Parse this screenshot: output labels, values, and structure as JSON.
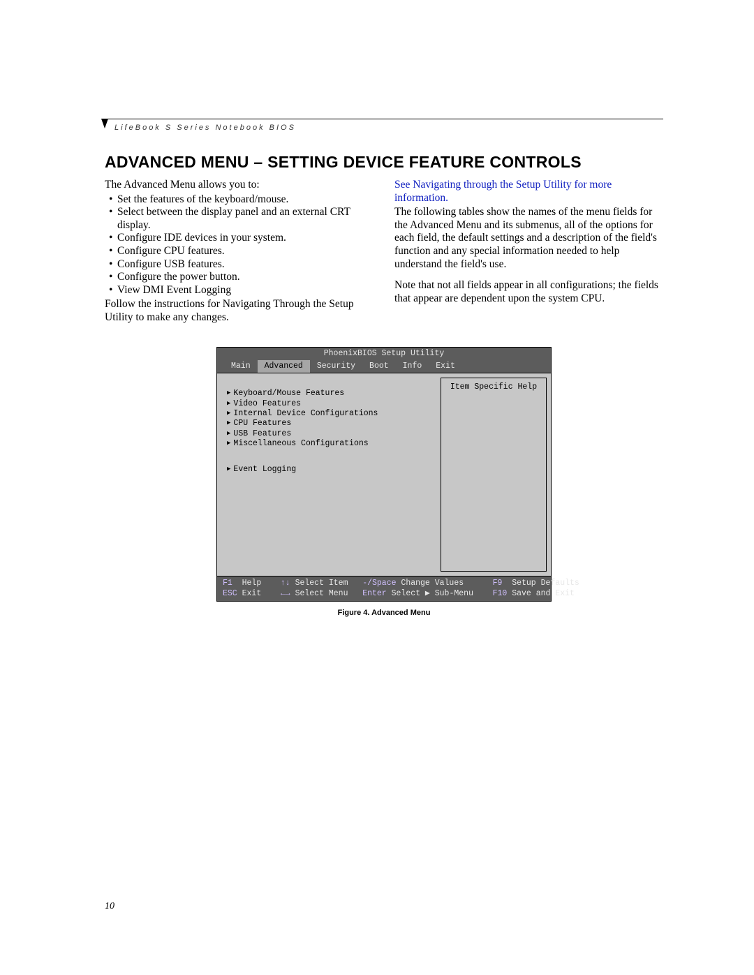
{
  "running_head": "LifeBook S Series Notebook BIOS",
  "title": "ADVANCED MENU – SETTING DEVICE FEATURE CONTROLS",
  "left_intro": "The Advanced Menu allows you to:",
  "left_bullets": [
    "Set the features of the keyboard/mouse.",
    "Select between the display panel and an external CRT display.",
    "Configure IDE devices in your system.",
    "Configure CPU features.",
    "Configure USB features.",
    "Configure the power button.",
    "View DMI Event Logging"
  ],
  "left_after": "Follow the instructions for Navigating Through the Setup Utility to make any changes.",
  "right_link": "See Navigating through the Setup Utility for more information.",
  "right_p1": "The following tables show the names of the menu fields for the Advanced Menu and its submenus, all of the options for each field, the default settings and a description of the field's function and any special information needed to help understand the field's use.",
  "right_p2": "Note that not all fields appear in all configurations; the fields that appear are dependent upon the system CPU.",
  "bios": {
    "title": "PhoenixBIOS Setup Utility",
    "tabs": [
      "Main",
      "Advanced",
      "Security",
      "Boot",
      "Info",
      "Exit"
    ],
    "active_tab": "Advanced",
    "help_title": "Item Specific Help",
    "items_group1": [
      "Keyboard/Mouse Features",
      "Video Features",
      "Internal Device Configurations",
      "CPU Features",
      "USB Features",
      "Miscellaneous Configurations"
    ],
    "items_group2": [
      "Event Logging"
    ],
    "footer": {
      "f1": "F1",
      "help": "Help",
      "arrows_ud": "↑↓",
      "select_item": "Select Item",
      "minus_space": "-/Space",
      "change_values": "Change Values",
      "f9": "F9",
      "setup_defaults": "Setup Defaults",
      "esc": "ESC",
      "exit": "Exit",
      "arrows_lr": "←→",
      "select_menu": "Select Menu",
      "enter": "Enter",
      "select_sub": "Select ▶ Sub-Menu",
      "f10": "F10",
      "save_exit": "Save and Exit"
    }
  },
  "caption": "Figure 4.  Advanced Menu",
  "page_number": "10"
}
